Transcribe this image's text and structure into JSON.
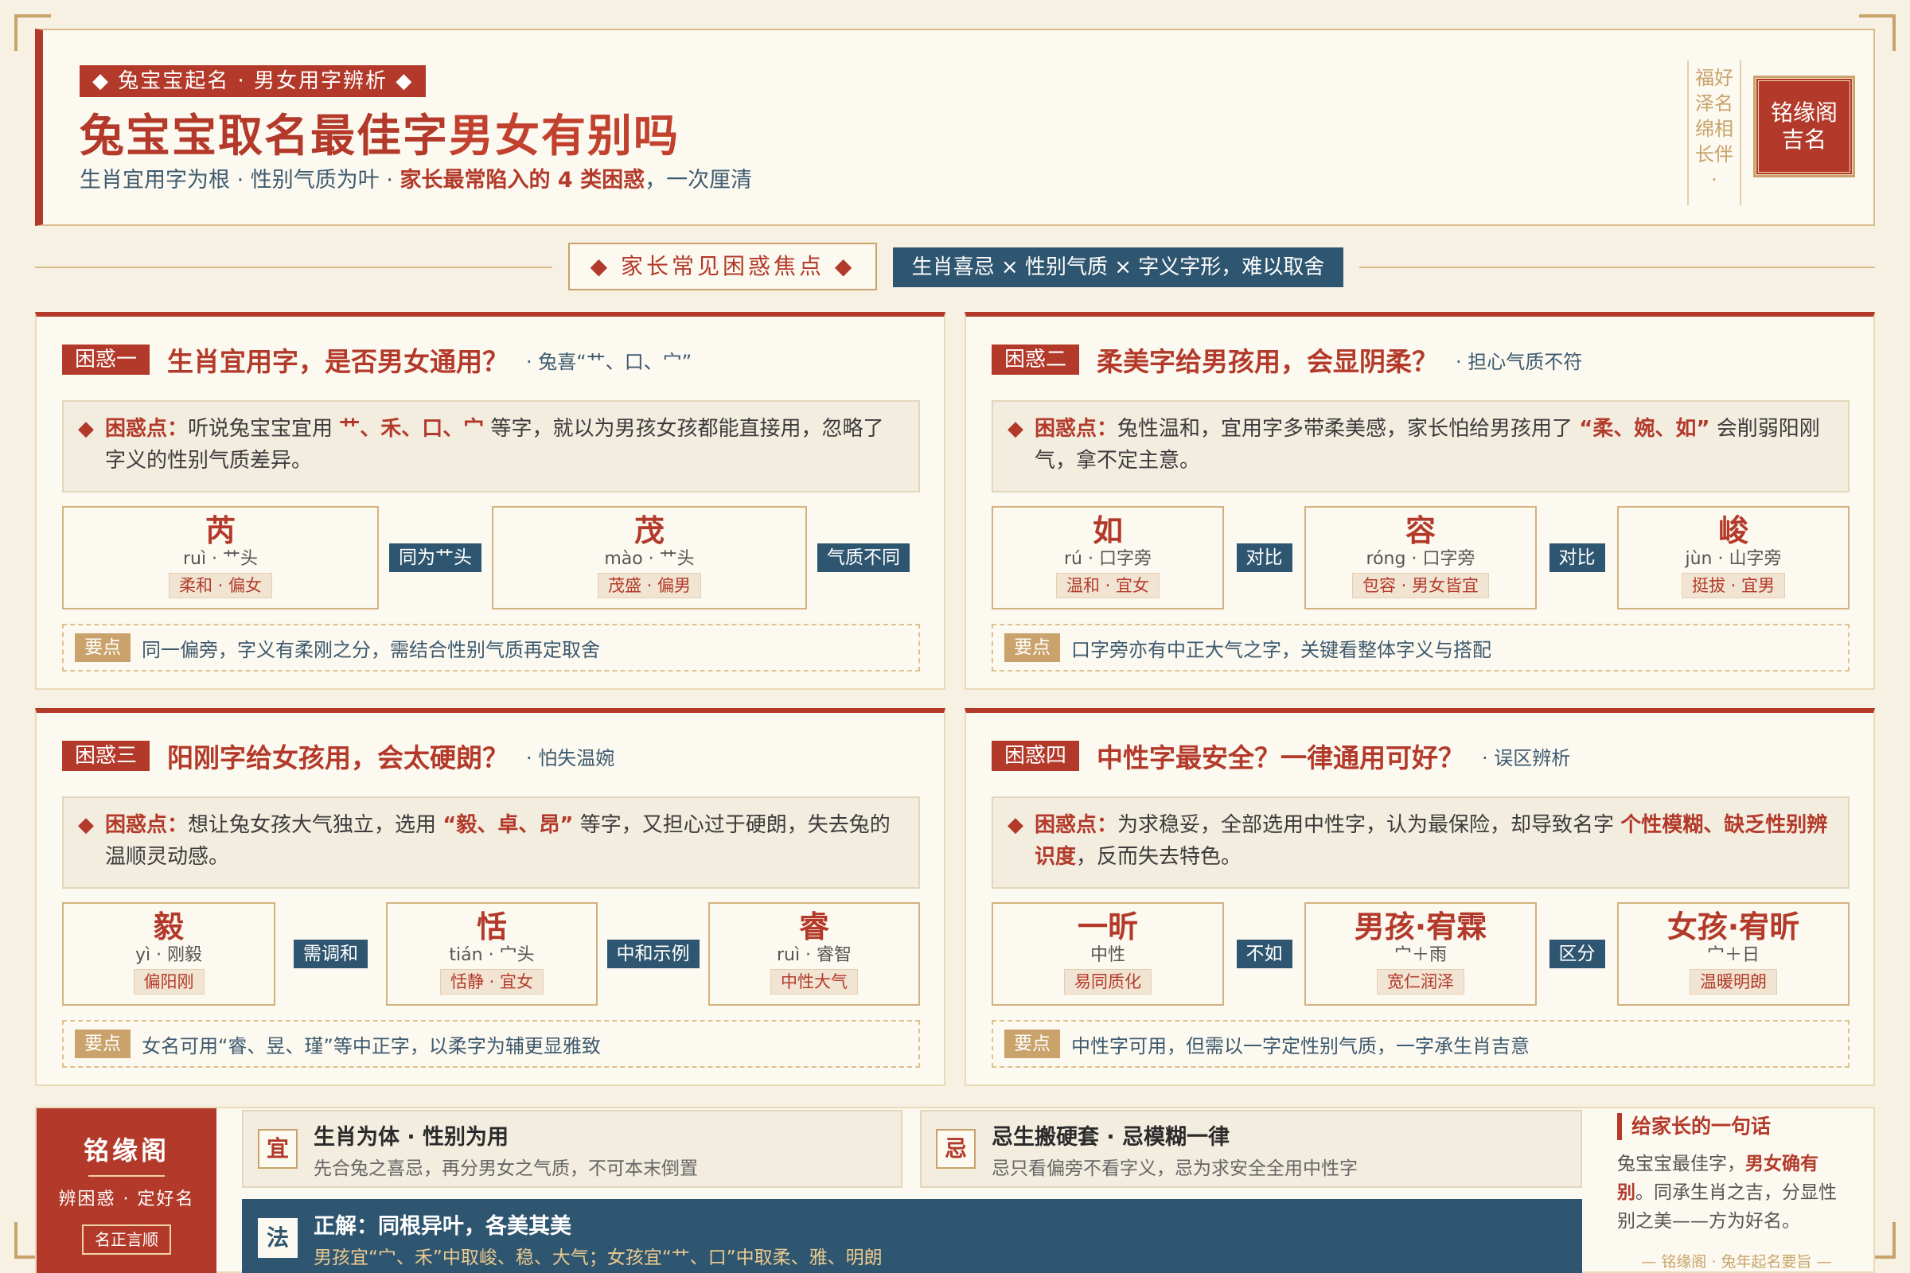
{
  "header": {
    "tagline": "◆ 兔宝宝起名 · 男女用字辨析 ◆",
    "title_part1": "兔宝宝取名最佳字",
    "title_part2": "男女有别吗",
    "subtitle_pre": "生肖宜用字为根 · 性别气质为叶 · ",
    "subtitle_highlight": "家长最常陷入的 4 类困惑",
    "subtitle_post": "，一次厘清",
    "vertical_lines": [
      "福好",
      "泽名",
      "绵相",
      "长伴",
      "·"
    ],
    "seal_line1": "铭缘阁",
    "seal_line2": "吉名"
  },
  "divider": {
    "focus_label": "◆ 家长常见困惑焦点 ◆",
    "focus_bar": "生肖喜忌 × 性别气质 × 字义字形，难以取舍"
  },
  "cards": [
    {
      "badge": "困惑一",
      "title": "生肖宜用字，是否男女通用？",
      "note": "· 兔喜“艹、口、宀”",
      "problem_label": "困惑点：",
      "problem_pre": "听说兔宝宝宜用 ",
      "problem_hl": "艹、禾、口、宀",
      "problem_post": " 等字，就以为男孩女孩都能直接用，忽略了字义的性别气质差异。",
      "chars": [
        {
          "ch": "芮",
          "py": "ruì · 艹头",
          "tag": "柔和 · 偏女"
        },
        {
          "ch": "茂",
          "py": "mào · 艹头",
          "tag": "茂盛 · 偏男"
        }
      ],
      "connectors": [
        "同为艹头",
        "气质不同"
      ],
      "key_label": "要点",
      "key_text": "同一偏旁，字义有柔刚之分，需结合性别气质再定取舍"
    },
    {
      "badge": "困惑二",
      "title": "柔美字给男孩用，会显阴柔？",
      "note": "· 担心气质不符",
      "problem_label": "困惑点：",
      "problem_pre": "兔性温和，宜用字多带柔美感，家长怕给男孩用了 ",
      "problem_hl": "“柔、婉、如”",
      "problem_post": " 会削弱阳刚气，拿不定主意。",
      "chars": [
        {
          "ch": "如",
          "py": "rú · 口字旁",
          "tag": "温和 · 宜女"
        },
        {
          "ch": "容",
          "py": "róng · 口字旁",
          "tag": "包容 · 男女皆宜"
        },
        {
          "ch": "峻",
          "py": "jùn · 山字旁",
          "tag": "挺拔 · 宜男"
        }
      ],
      "connectors": [
        "对比",
        "对比"
      ],
      "key_label": "要点",
      "key_text": "口字旁亦有中正大气之字，关键看整体字义与搭配"
    },
    {
      "badge": "困惑三",
      "title": "阳刚字给女孩用，会太硬朗？",
      "note": "· 怕失温婉",
      "problem_label": "困惑点：",
      "problem_pre": "想让兔女孩大气独立，选用 ",
      "problem_hl": "“毅、卓、昂”",
      "problem_post": " 等字，又担心过于硬朗，失去兔的温顺灵动感。",
      "chars": [
        {
          "ch": "毅",
          "py": "yì · 刚毅",
          "tag": "偏阳刚"
        },
        {
          "ch": "恬",
          "py": "tián · 宀头",
          "tag": "恬静 · 宜女"
        },
        {
          "ch": "睿",
          "py": "ruì · 睿智",
          "tag": "中性大气"
        }
      ],
      "connectors": [
        "需调和",
        "中和示例"
      ],
      "key_label": "要点",
      "key_text": "女名可用“睿、昱、瑾”等中正字，以柔字为辅更显雅致"
    },
    {
      "badge": "困惑四",
      "title": "中性字最安全？一律通用可好？",
      "note": "· 误区辨析",
      "problem_label": "困惑点：",
      "problem_pre": "为求稳妥，全部选用中性字，认为最保险，却导致名字 ",
      "problem_hl": "个性模糊、缺乏性别辨识度",
      "problem_post": "，反而失去特色。",
      "chars": [
        {
          "ch": "一昕",
          "py": "中性",
          "tag": "易同质化"
        },
        {
          "ch": "男孩·宥霖",
          "py": "宀＋雨",
          "tag": "宽仁润泽"
        },
        {
          "ch": "女孩·宥昕",
          "py": "宀＋日",
          "tag": "温暖明朗"
        }
      ],
      "connectors": [
        "不如",
        "区分"
      ],
      "key_label": "要点",
      "key_text": "中性字可用，但需以一字定性别气质，一字承生肖吉意"
    }
  ],
  "footer": {
    "brand_name": "铭缘阁",
    "brand_slogan": "辨困惑 · 定好名",
    "brand_motto": "名正言顺",
    "yi_mark": "宜",
    "yi_title": "生肖为体 · 性别为用",
    "yi_desc": "先合兔之喜忌，再分男女之气质，不可本末倒置",
    "ji_mark": "忌",
    "ji_title": "忌生搬硬套 · 忌模糊一律",
    "ji_desc": "忌只看偏旁不看字义，忌为求安全全用中性字",
    "fa_mark": "法",
    "fa_title": "正解：同根异叶，各美其美",
    "fa_desc": "男孩宜“宀、禾”中取峻、稳、大气；女孩宜“艹、口”中取柔、雅、明朗",
    "advice_title": "给家长的一句话",
    "advice_pre": "兔宝宝最佳字，",
    "advice_hl": "男女确有别",
    "advice_post": "。同承生肖之吉，分显性别之美——方为好名。",
    "advice_foot": "— 铭缘阁 · 兔年起名要旨 —"
  }
}
